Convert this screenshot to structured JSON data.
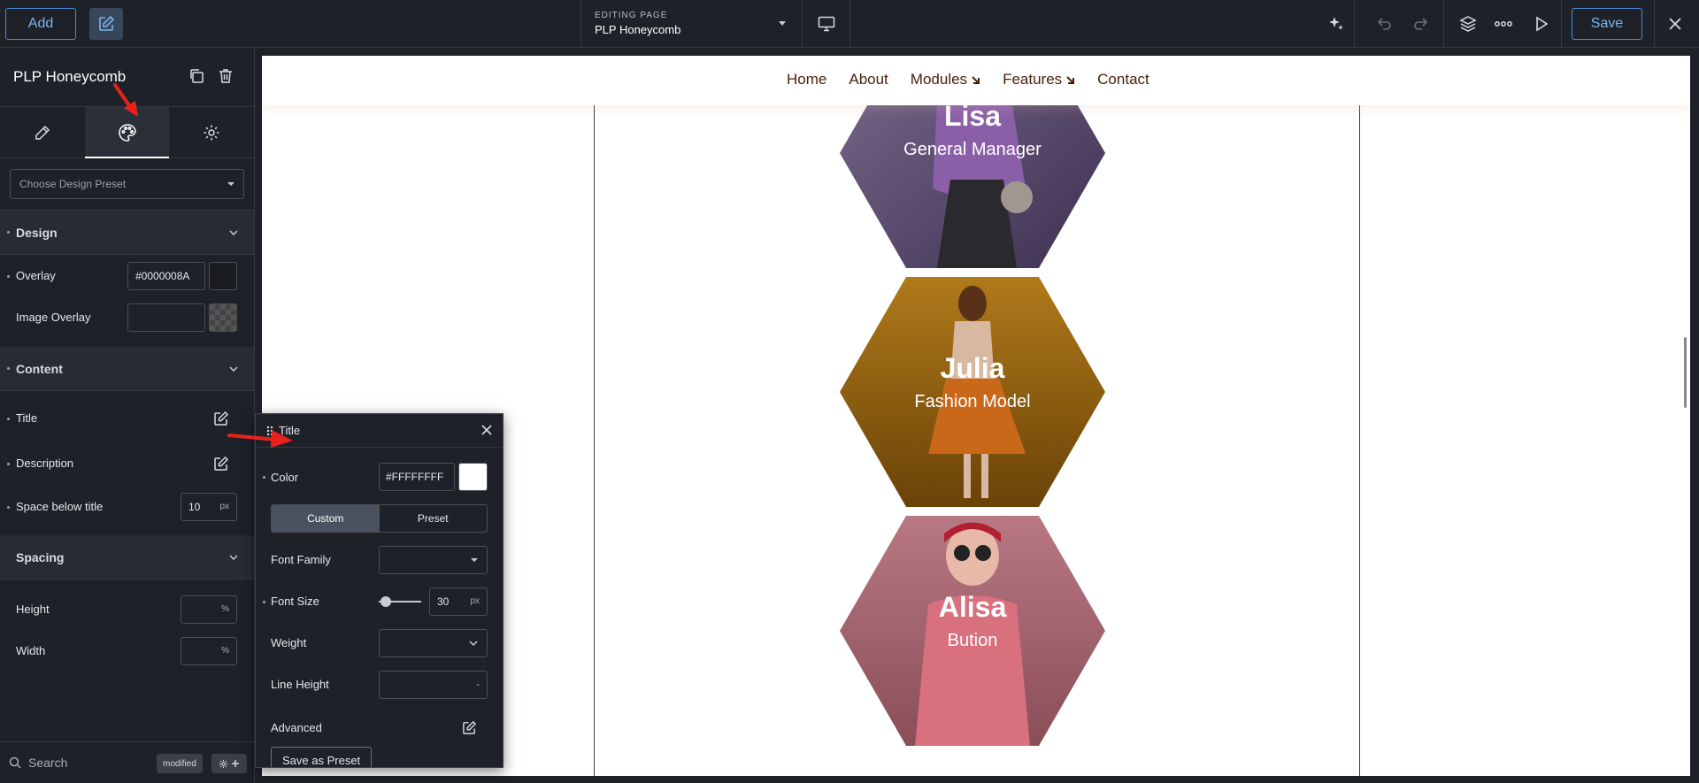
{
  "topbar": {
    "add_label": "Add",
    "editing_label": "EDITING PAGE",
    "page_name": "PLP Honeycomb",
    "save_label": "Save"
  },
  "left_panel": {
    "title": "PLP Honeycomb",
    "preset_placeholder": "Choose Design Preset",
    "design_section": "Design",
    "overlay_label": "Overlay",
    "overlay_value": "#0000008A",
    "image_overlay_label": "Image Overlay",
    "content_section": "Content",
    "title_label": "Title",
    "description_label": "Description",
    "space_below_label": "Space below title",
    "space_below_value": "10",
    "space_below_unit": "px",
    "spacing_section": "Spacing",
    "height_label": "Height",
    "height_unit": "%",
    "width_label": "Width",
    "width_unit": "%",
    "search_label": "Search",
    "modified_badge": "modified"
  },
  "title_panel": {
    "heading": "Title",
    "color_label": "Color",
    "color_value": "#FFFFFFFF",
    "custom_label": "Custom",
    "preset_label": "Preset",
    "font_family_label": "Font Family",
    "font_size_label": "Font Size",
    "font_size_value": "30",
    "font_size_unit": "px",
    "weight_label": "Weight",
    "line_height_label": "Line Height",
    "line_height_value": "-",
    "advanced_label": "Advanced",
    "save_preset_label": "Save as Preset"
  },
  "site": {
    "nav": [
      "Home",
      "About",
      "Modules",
      "Features",
      "Contact"
    ],
    "members": [
      {
        "name": "Lisa",
        "role": "General Manager",
        "color": "#5a4a6e"
      },
      {
        "name": "Julia",
        "role": "Fashion Model",
        "color": "#8a5a10"
      },
      {
        "name": "Alisa",
        "role": "Bution",
        "color": "#9a5f68"
      }
    ]
  },
  "colors": {
    "accent": "#4d8ad6",
    "annotation_arrow": "#e8221b"
  }
}
